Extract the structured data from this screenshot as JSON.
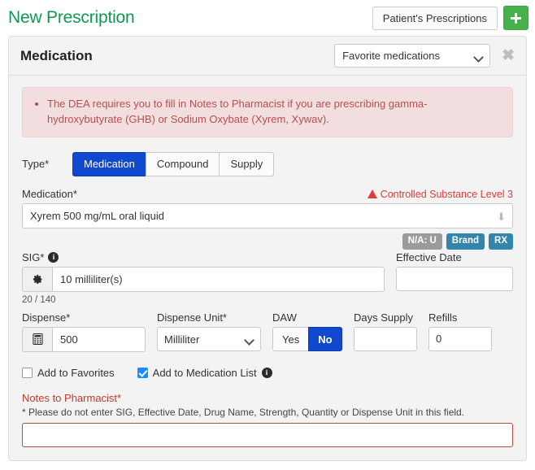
{
  "header": {
    "title": "New Prescription",
    "patient_prescriptions_label": "Patient's Prescriptions",
    "add_icon": "plus-icon"
  },
  "panel": {
    "title": "Medication",
    "favorites_select": {
      "selected": "Favorite medications",
      "options": [
        "Favorite medications"
      ]
    },
    "close_label": "✖"
  },
  "alert": {
    "text": "The DEA requires you to fill in Notes to Pharmacist if you are prescribing gamma-hydroxybutyrate (GHB) or Sodium Oxybate (Xyrem, Xywav)."
  },
  "type": {
    "label": "Type*",
    "options": [
      "Medication",
      "Compound",
      "Supply"
    ],
    "selected": "Medication"
  },
  "medication": {
    "label": "Medication*",
    "warning": "Controlled Substance Level 3",
    "warning_icon": "warning-triangle-icon",
    "value": "Xyrem 500 mg/mL oral liquid",
    "caret_icon": "chevron-down-icon",
    "badges": [
      {
        "text": "N/A: U",
        "style": "gray"
      },
      {
        "text": "Brand",
        "style": "teal"
      },
      {
        "text": "RX",
        "style": "teal"
      }
    ]
  },
  "sig": {
    "label": "SIG*",
    "info_icon": "info-icon",
    "settings_icon": "gear-icon",
    "value": "10 milliliter(s)",
    "counter": "20 / 140"
  },
  "effective_date": {
    "label": "Effective Date",
    "value": ""
  },
  "dispense": {
    "label": "Dispense*",
    "calculator_icon": "calculator-icon",
    "value": "500"
  },
  "dispense_unit": {
    "label": "Dispense Unit*",
    "selected": "Milliliter",
    "options": [
      "Milliliter"
    ]
  },
  "daw": {
    "label": "DAW",
    "options": [
      "Yes",
      "No"
    ],
    "selected": "No"
  },
  "days_supply": {
    "label": "Days Supply",
    "value": ""
  },
  "refills": {
    "label": "Refills",
    "value": "0"
  },
  "checkboxes": [
    {
      "label": "Add to Favorites",
      "checked": false,
      "has_info": false
    },
    {
      "label": "Add to Medication List",
      "checked": true,
      "has_info": true
    }
  ],
  "notes": {
    "label": "Notes to Pharmacist*",
    "help": "* Please do not enter SIG, Effective Date, Drug Name, Strength, Quantity or Dispense Unit in this field.",
    "value": ""
  },
  "colors": {
    "title_green": "#0f9950",
    "add_green": "#47b14b",
    "primary_blue": "#1048cf",
    "checkbox_blue": "#1a8cff",
    "alert_bg": "#f2dede",
    "alert_text": "#b4504f",
    "warning_red": "#e03a3a",
    "notes_red": "#c0392b",
    "badge_gray": "#9b9b9b",
    "badge_teal": "#3584ab"
  }
}
